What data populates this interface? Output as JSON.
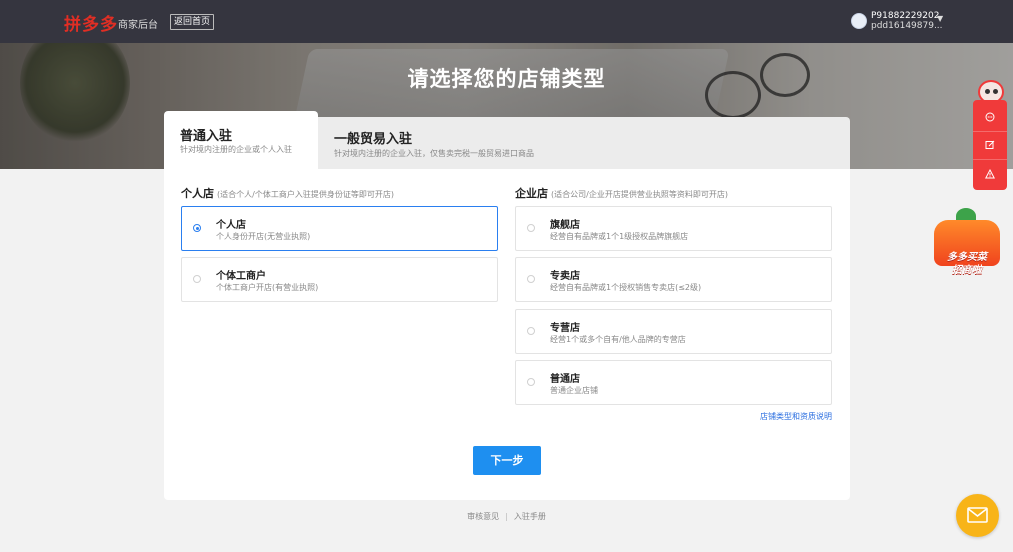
{
  "header": {
    "logo_text": "拼多多",
    "logo_sub": "商家后台",
    "back_label": "返回首页",
    "account_id": "P91882229202",
    "account_name": "pdd16149879..."
  },
  "hero": {
    "title": "请选择您的店铺类型"
  },
  "tabs": [
    {
      "title": "普通入驻",
      "desc": "针对境内注册的企业或个人入驻",
      "active": true
    },
    {
      "title": "一般贸易入驻",
      "desc": "针对境内注册的企业入驻，仅售卖完税一般贸易进口商品",
      "active": false
    }
  ],
  "personal": {
    "heading": "个人店",
    "hint": "(适合个人/个体工商户入驻提供身份证等即可开店)",
    "options": [
      {
        "title": "个人店",
        "desc": "个人身份开店(无营业执照)",
        "selected": true
      },
      {
        "title": "个体工商户",
        "desc": "个体工商户开店(有营业执照)",
        "selected": false
      }
    ]
  },
  "enterprise": {
    "heading": "企业店",
    "hint": "(适合公司/企业开店提供营业执照等资料即可开店)",
    "options": [
      {
        "title": "旗舰店",
        "desc": "经营自有品牌或1个1级授权品牌旗舰店"
      },
      {
        "title": "专卖店",
        "desc": "经营自有品牌或1个授权销售专卖店(≤2级)"
      },
      {
        "title": "专营店",
        "desc": "经营1个或多个自有/他人品牌的专营店"
      },
      {
        "title": "普通店",
        "desc": "普通企业店铺"
      }
    ],
    "link": "店铺类型和资质说明"
  },
  "next_label": "下一步",
  "footer": {
    "links": [
      "审核意见",
      "入驻手册"
    ],
    "separator": "|"
  },
  "promo": {
    "line1": "多多买菜",
    "line2": "招商啦"
  },
  "colors": {
    "accent": "#1e8ff0",
    "brand": "#e02e24",
    "header_bg": "#35353f",
    "side_tools": "#f03a3a"
  },
  "icons": [
    "chat-icon",
    "edit-icon",
    "warning-icon",
    "mail-icon"
  ]
}
